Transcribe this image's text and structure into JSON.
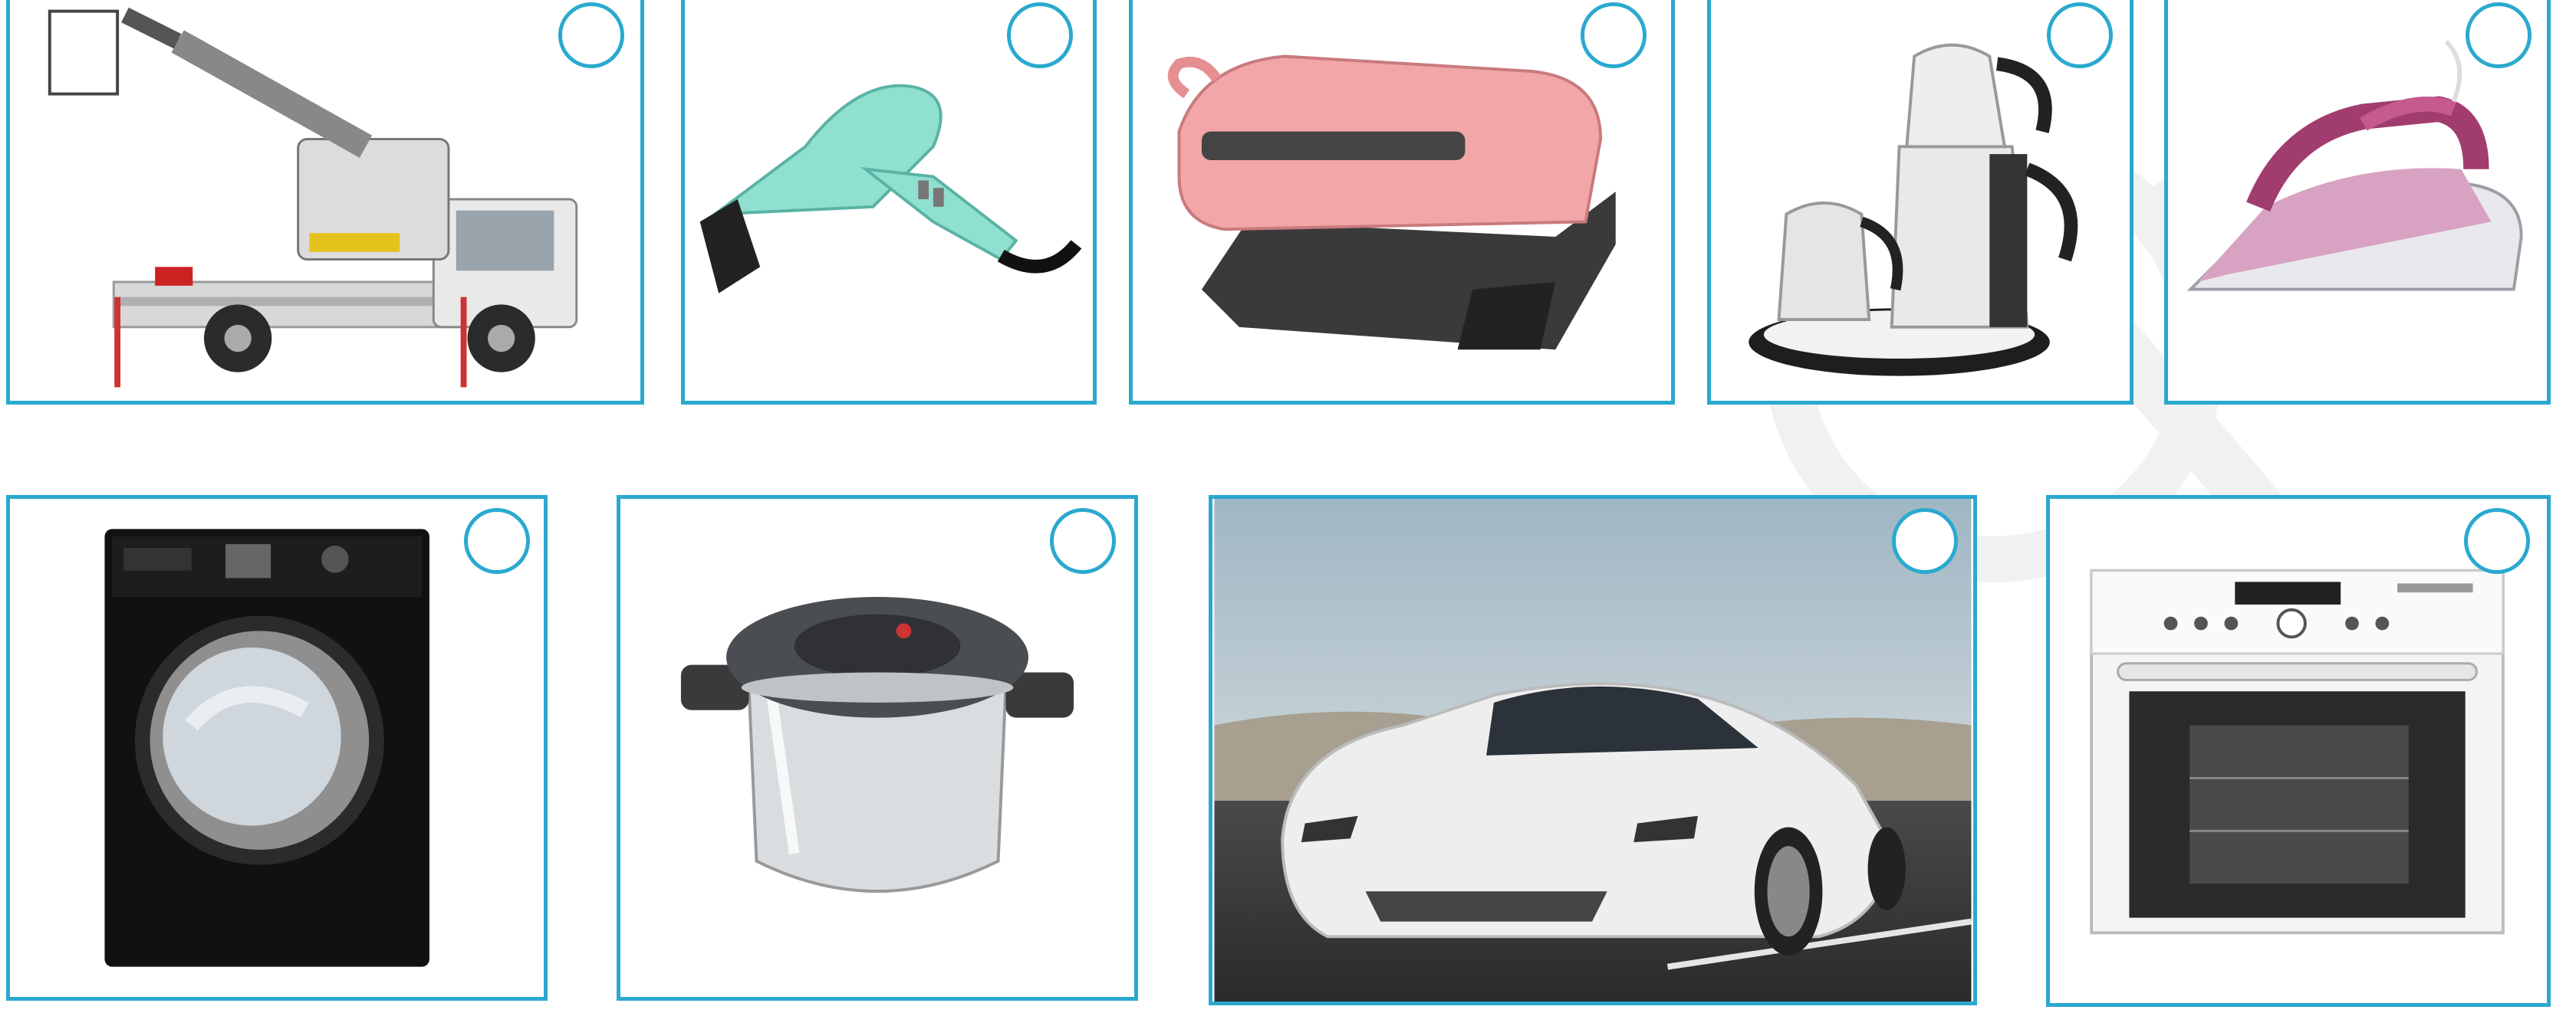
{
  "items": [
    {
      "icon": "truck-crane-icon"
    },
    {
      "icon": "hair-dryer-icon"
    },
    {
      "icon": "toaster-grill-icon"
    },
    {
      "icon": "tea-maker-icon"
    },
    {
      "icon": "steam-iron-icon"
    },
    {
      "icon": "washing-machine-icon"
    },
    {
      "icon": "pressure-cooker-icon"
    },
    {
      "icon": "sports-car-icon"
    },
    {
      "icon": "built-in-oven-icon"
    }
  ],
  "colors": {
    "border": "#2aa9cf",
    "watermark": "#f2f2f2"
  }
}
